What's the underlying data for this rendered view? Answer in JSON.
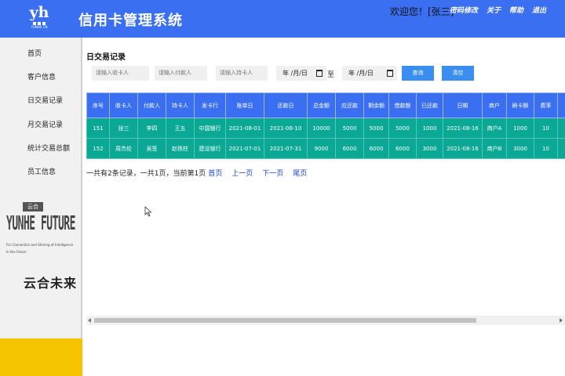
{
  "header": {
    "logo_text": "yh",
    "logo_sub": "YUNHE CN",
    "title": "信用卡管理系统",
    "welcome": "欢迎您！[张三]",
    "links": [
      "密码修改",
      "关于",
      "帮助",
      "退出"
    ]
  },
  "sidebar": {
    "items": [
      "首页",
      "客户信息",
      "日交易记录",
      "月交易记录",
      "统计交易总额",
      "员工信息"
    ],
    "brand_tag": "云合",
    "brand_big": "YUNHE FUTURE",
    "brand_desc": "For Connection and Sharing of Intelligence",
    "brand_desc2": "In the Future",
    "brand_cn": "云合未来"
  },
  "main": {
    "title": "日交易记录",
    "filters": {
      "card_receiver_placeholder": "请输入收卡人",
      "payer_placeholder": "请输入付款人",
      "holder_placeholder": "请输入持卡人",
      "date_from": "年 /月/日",
      "to_label": "至",
      "date_to": "年 /月/日",
      "query_label": "查询",
      "clear_label": "清空"
    },
    "table": {
      "columns": [
        "序号",
        "收卡人",
        "付款人",
        "持卡人",
        "发卡行",
        "账单日",
        "还款日",
        "总金额",
        "应还款",
        "剩余额",
        "借款额",
        "已还款",
        "日期",
        "商户",
        "刷卡额",
        "费率",
        ""
      ],
      "rows": [
        [
          "151",
          "张三",
          "李四",
          "王五",
          "中国银行",
          "2021-08-01",
          "2021-08-10",
          "10000",
          "5000",
          "5000",
          "5000",
          "1000",
          "2021-08-16",
          "商户A",
          "1000",
          "10",
          ""
        ],
        [
          "152",
          "周杰伦",
          "吴签",
          "赵铁柱",
          "建设银行",
          "2021-07-01",
          "2021-07-31",
          "9000",
          "6000",
          "6000",
          "6000",
          "3000",
          "2021-08-16",
          "商户B",
          "3000",
          "10",
          ""
        ]
      ]
    },
    "pager": {
      "summary": "一共有2条记录，一共1页，当前第1页",
      "first": "首页",
      "prev": "上一页",
      "next": "下一页",
      "last": "尾页"
    }
  },
  "colors": {
    "header_blue": "#3a6ff2",
    "row_teal": "#0aa895",
    "button_blue": "#3a8ef0",
    "accent_yellow": "#f5c400"
  },
  "icons": [
    "calendar-icon",
    "mouse-cursor-icon"
  ]
}
